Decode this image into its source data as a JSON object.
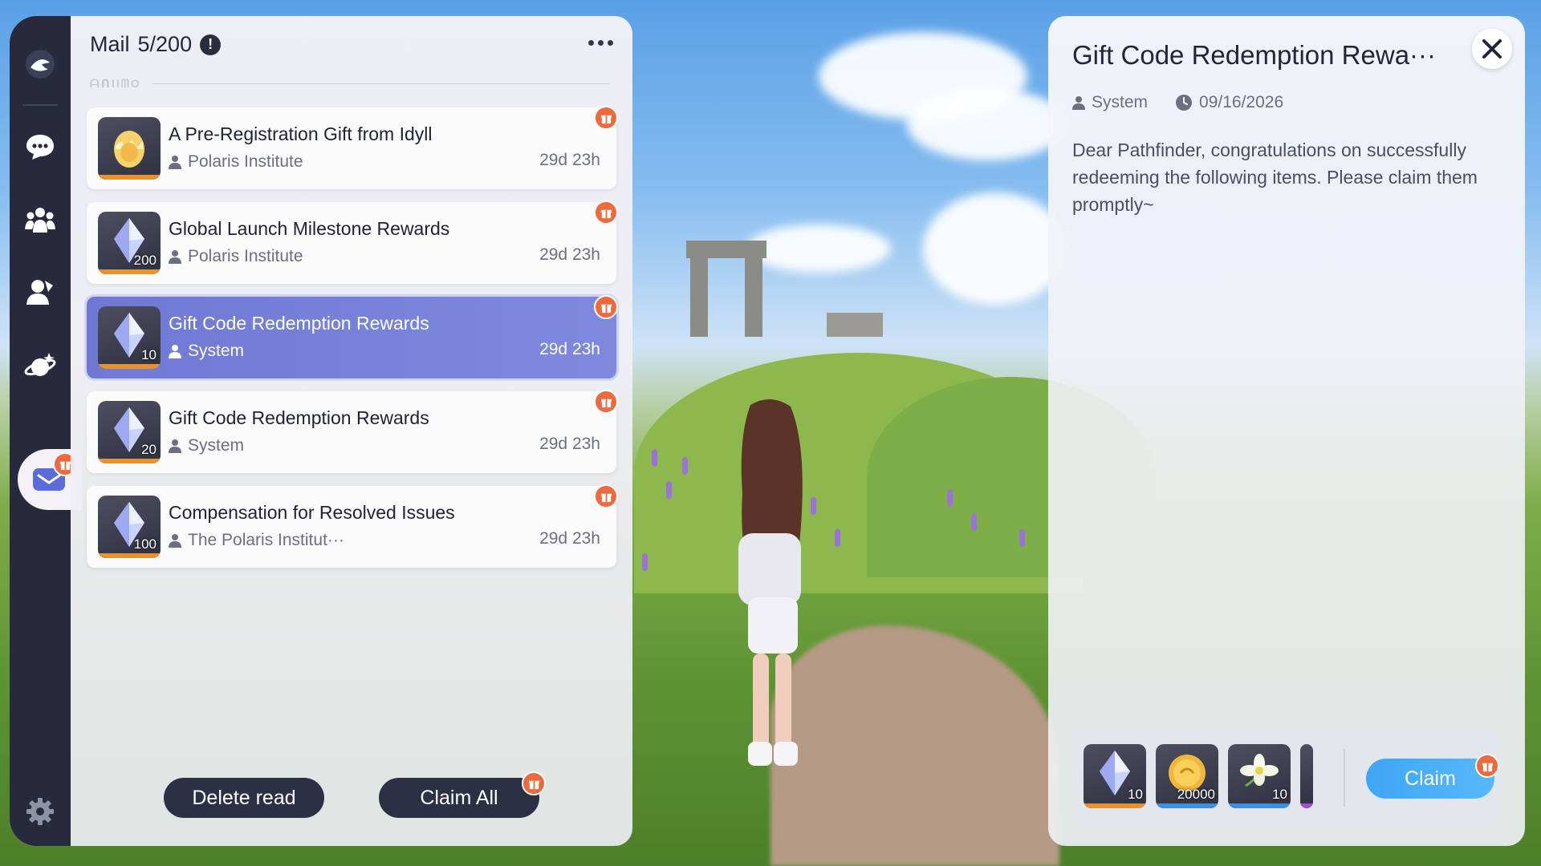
{
  "nav": {
    "items": [
      {
        "icon": "logo-icon"
      },
      {
        "icon": "chat-icon"
      },
      {
        "icon": "community-icon"
      },
      {
        "icon": "friends-icon"
      },
      {
        "icon": "planet-icon"
      },
      {
        "icon": "mail-icon",
        "active": true,
        "badge": "gift"
      },
      {
        "icon": "gear-icon"
      }
    ]
  },
  "mail": {
    "title": "Mail",
    "count": "5/200",
    "items": [
      {
        "subject": "A Pre-Registration Gift from Idyll",
        "sender": "Polaris Institute",
        "time": "29d 23h",
        "thumb": "egg-icon",
        "qty": "",
        "selected": false
      },
      {
        "subject": "Global Launch Milestone Rewards",
        "sender": "Polaris Institute",
        "time": "29d 23h",
        "thumb": "crystal-icon",
        "qty": "200",
        "selected": false
      },
      {
        "subject": "Gift Code Redemption Rewards",
        "sender": "System",
        "time": "29d 23h",
        "thumb": "crystal-icon",
        "qty": "10",
        "selected": true
      },
      {
        "subject": "Gift Code Redemption Rewards",
        "sender": "System",
        "time": "29d 23h",
        "thumb": "crystal-icon",
        "qty": "20",
        "selected": false
      },
      {
        "subject": "Compensation for Resolved Issues",
        "sender": "The Polaris Institut···",
        "time": "29d 23h",
        "thumb": "crystal-icon",
        "qty": "100",
        "selected": false
      }
    ],
    "delete_label": "Delete read",
    "claim_all_label": "Claim All"
  },
  "detail": {
    "title": "Gift Code Redemption Rewa···",
    "sender": "System",
    "date": "09/16/2026",
    "body": "Dear Pathfinder, congratulations on successfully redeeming the following items. Please claim them promptly~",
    "rewards": [
      {
        "icon": "crystal-icon",
        "qty": "10",
        "rarity_color": "#e6922e"
      },
      {
        "icon": "coin-icon",
        "qty": "20000",
        "rarity_color": "#3e8fe0"
      },
      {
        "icon": "flower-icon",
        "qty": "10",
        "rarity_color": "#3e8fe0"
      }
    ],
    "claim_label": "Claim"
  },
  "colors": {
    "accent_selected": "#7580d9",
    "gift_badge": "#ee6a3c",
    "claim_button": "#47aff8",
    "rail": "#262a3c"
  }
}
